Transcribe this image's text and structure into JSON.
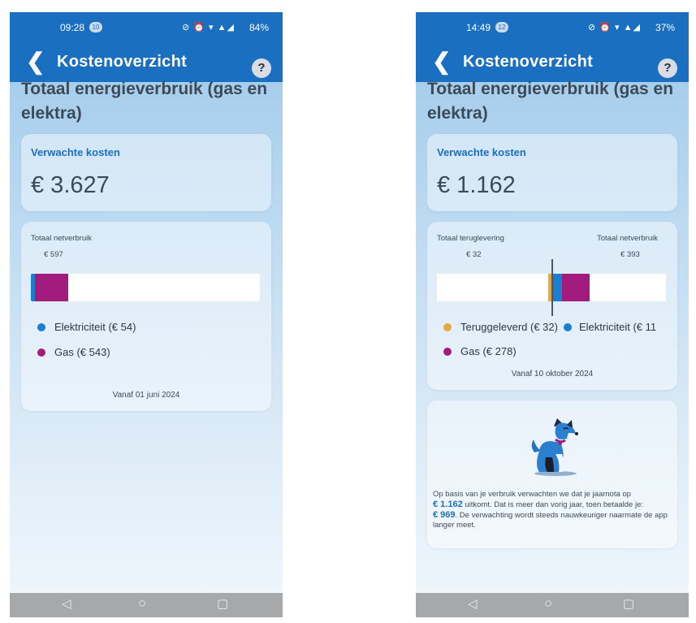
{
  "screens": [
    {
      "status": {
        "time": "09:28",
        "notification_count": "10",
        "icons": "⊘ ⏰ ▾ ▲◢",
        "battery": "84%"
      },
      "nav": {
        "back": "❮",
        "title": "Kostenoverzicht",
        "help": "?"
      },
      "heading": "Totaal energieverbruik (gas en elektra)",
      "cost": {
        "label": "Verwachte kosten",
        "value": "€ 3.627"
      },
      "usage": {
        "net_label": "Totaal netverbruik",
        "net_value": "€ 597",
        "bar_fractions": {
          "electricity": 0.018,
          "gas": 0.145
        },
        "legend": [
          {
            "label": "Elektriciteit (€ 54)",
            "color": "#1a7fd0"
          },
          {
            "label": "Gas (€ 543)",
            "color": "#a21c7e"
          }
        ],
        "since": "Vanaf 01 juni 2024"
      },
      "sysnav": {
        "back": "◁",
        "home": "○",
        "recent": "▢"
      }
    },
    {
      "status": {
        "time": "14:49",
        "notification_count": "12",
        "icons": "⊘ ⏰ ▾ ▲◢",
        "battery": "37%"
      },
      "nav": {
        "back": "❮",
        "title": "Kostenoverzicht",
        "help": "?"
      },
      "heading": "Totaal energieverbruik (gas en elektra)",
      "cost": {
        "label": "Verwachte kosten",
        "value": "€ 1.162"
      },
      "usage": {
        "return_label": "Totaal teruglevering",
        "return_value": "€ 32",
        "net_label": "Totaal netverbruik",
        "net_value": "€ 393",
        "bar_fractions": {
          "returned": 0.015,
          "electricity": 0.045,
          "gas": 0.122
        },
        "legend": [
          {
            "label": "Teruggeleverd (€ 32)",
            "color": "#e9a63a"
          },
          {
            "label": "Elektriciteit (€ 11",
            "color": "#1a7fd0"
          },
          {
            "label": "Gas (€ 278)",
            "color": "#a21c7e"
          }
        ],
        "since": "Vanaf 10 oktober 2024"
      },
      "info": {
        "text_1": "Op basis van je verbruik verwachten we dat je jaarnota op",
        "amount_1": "€ 1.162",
        "text_2": "uitkomt. Dat is meer dan vorig jaar, toen betaalde je:",
        "amount_2": "€ 969",
        "text_3": ". De verwachting wordt steeds nauwkeuriger naarmate de app langer meet."
      },
      "sysnav": {
        "back": "◁",
        "home": "○",
        "recent": "▢"
      }
    }
  ]
}
